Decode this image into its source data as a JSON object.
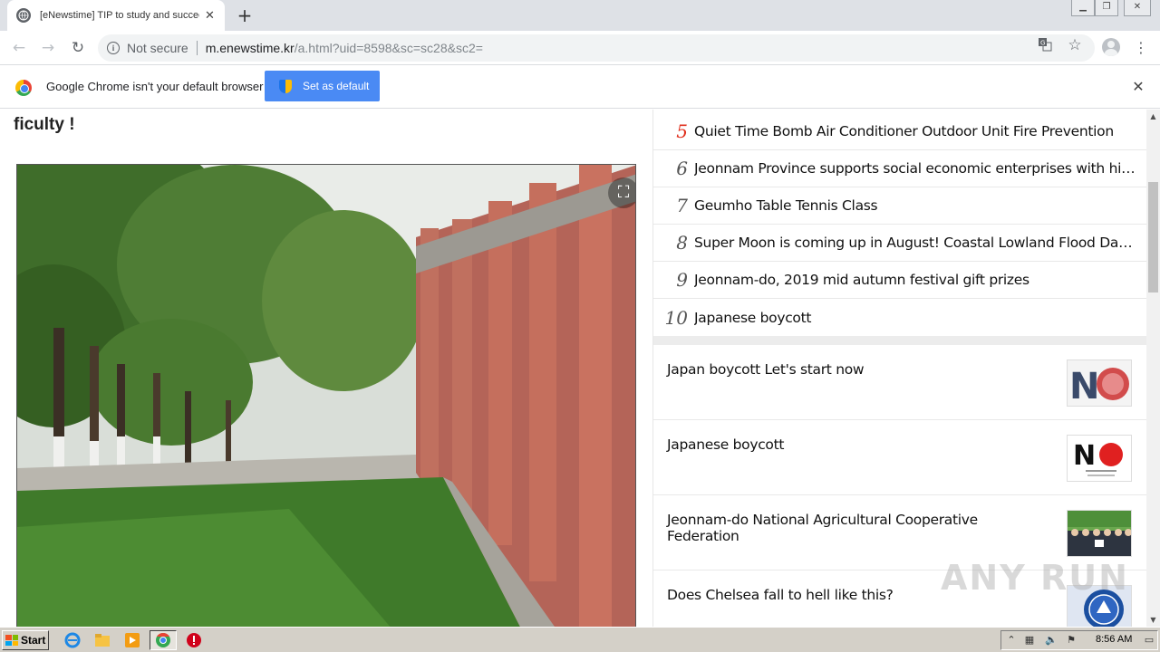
{
  "browser": {
    "tab_title": "[eNewstime] TIP to study and succeed",
    "security_label": "Not secure",
    "url_host": "m.enewstime.kr",
    "url_path": "/a.html?uid=8598&sc=sc28&sc2="
  },
  "infobar": {
    "message": "Google Chrome isn't your default browser",
    "button_label": "Set as default"
  },
  "article": {
    "headline_tail": "ficulty !"
  },
  "ranking": [
    {
      "rank": "5",
      "title": "Quiet Time Bomb Air Conditioner Outdoor Unit Fire Prevention",
      "highlight": true
    },
    {
      "rank": "6",
      "title": "Jeonnam Province supports social economic enterprises with high gro...",
      "highlight": false
    },
    {
      "rank": "7",
      "title": "Geumho Table Tennis Class",
      "highlight": false
    },
    {
      "rank": "8",
      "title": "Super Moon is coming up in August! Coastal Lowland Flood Damage ...",
      "highlight": false
    },
    {
      "rank": "9",
      "title": "Jeonnam-do, 2019 mid autumn festival gift prizes",
      "highlight": false
    },
    {
      "rank": "10",
      "title": "Japanese boycott",
      "highlight": false
    }
  ],
  "news": [
    {
      "title": "Japan boycott Let's start now",
      "thumb": "no-collage"
    },
    {
      "title": "Japanese boycott",
      "thumb": "no-red-dot"
    },
    {
      "title": "Jeonnam-do National Agricultural Cooperative Federation",
      "thumb": "group-photo"
    },
    {
      "title": "Does Chelsea fall to hell like this?",
      "thumb": "chelsea-crest"
    }
  ],
  "watermark": "ANY RUN",
  "taskbar": {
    "start_label": "Start",
    "clock": "8:56 AM"
  },
  "colors": {
    "rank_highlight": "#e0301e",
    "accent_button": "#4a8af4"
  }
}
